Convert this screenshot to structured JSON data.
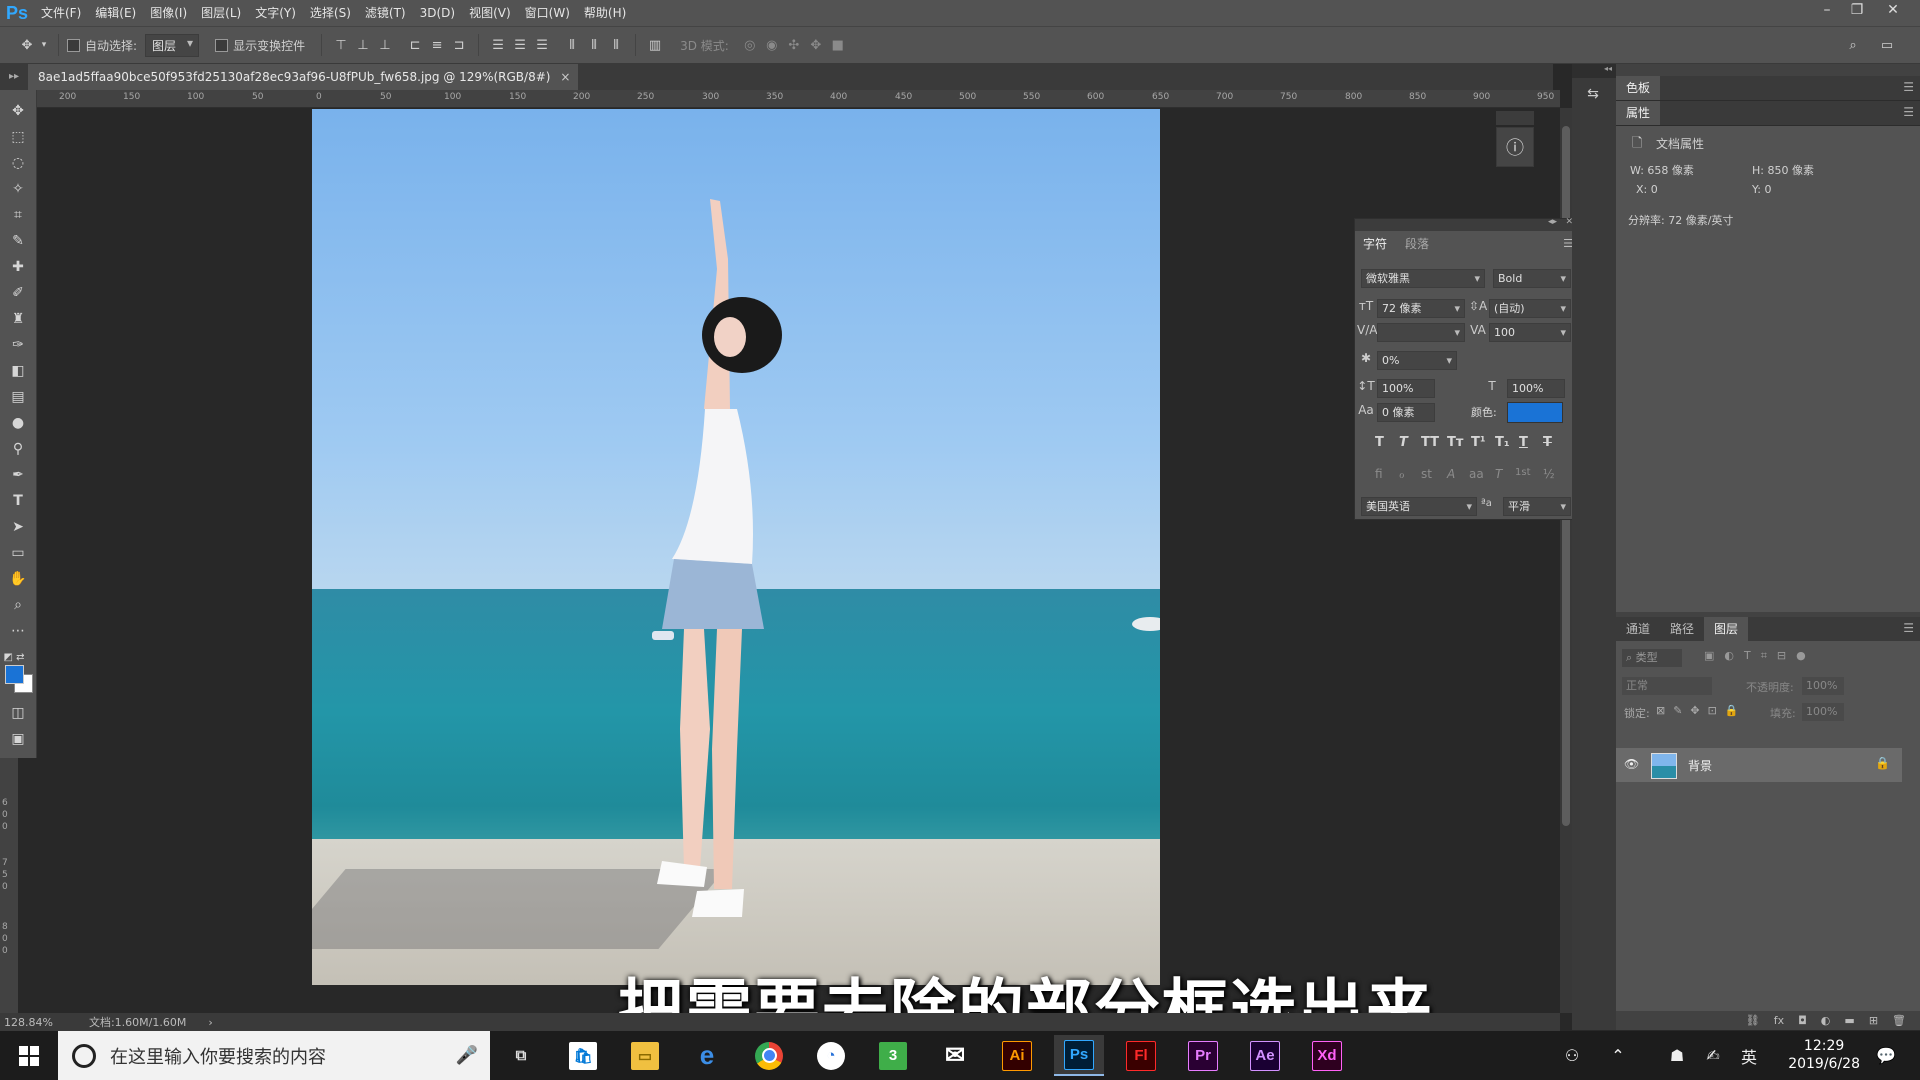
{
  "app": {
    "logo": "Ps"
  },
  "menu": [
    "文件(F)",
    "编辑(E)",
    "图像(I)",
    "图层(L)",
    "文字(Y)",
    "选择(S)",
    "滤镜(T)",
    "3D(D)",
    "视图(V)",
    "窗口(W)",
    "帮助(H)"
  ],
  "options": {
    "auto_select_label": "自动选择:",
    "auto_select_value": "图层",
    "show_transform_label": "显示变换控件",
    "mode_3d_label": "3D 模式:"
  },
  "document": {
    "tab_title": "8ae1ad5ffaa90bce50f953fd25130af28ec93af96-U8fPUb_fw658.jpg @ 129%(RGB/8#)",
    "close": "×"
  },
  "ruler_top": [
    "200",
    "150",
    "100",
    "50",
    "0",
    "50",
    "100",
    "150",
    "200",
    "250",
    "300",
    "350",
    "400",
    "450",
    "500",
    "550",
    "600",
    "650",
    "700",
    "750",
    "800",
    "850",
    "900",
    "950"
  ],
  "ruler_left": [
    "6",
    "0",
    "0",
    "7",
    "5",
    "0",
    "8",
    "0",
    "0"
  ],
  "status": {
    "zoom": "128.84%",
    "doc_size": "文档:1.60M/1.60M",
    "arrow": "›"
  },
  "subtitle": "把需要去除的部分框选出来",
  "character_panel": {
    "tabs": [
      "字符",
      "段落"
    ],
    "font_family": "微软雅黑",
    "font_style": "Bold",
    "font_size": "72 像素",
    "leading": "(自动)",
    "kerning": "",
    "tracking": "100",
    "tsume": "0%",
    "vertical_scale": "100%",
    "horizontal_scale": "100%",
    "baseline_shift": "0 像素",
    "color_label": "颜色:",
    "color": "#1a73d6",
    "type_styles": [
      "T",
      "T",
      "TT",
      "Tт",
      "T¹",
      "T₁",
      "T",
      "T"
    ],
    "opentype": [
      "fi",
      "ℴ",
      "st",
      "A",
      "aa",
      "T",
      "1st",
      "½"
    ],
    "language": "美国英语",
    "aa_label": "ªa",
    "antialias": "平滑"
  },
  "panels": {
    "swatches_tab": "色板",
    "properties_tab": "属性",
    "doc_props_label": "文档属性",
    "w": "W:  658 像素",
    "h": "H:  850 像素",
    "x": "X:  0",
    "y": "Y:  0",
    "resolution": "分辨率: 72 像素/英寸",
    "layer_tabs": [
      "通道",
      "路径",
      "图层"
    ],
    "kind_filter": "类型",
    "blend_mode": "正常",
    "opacity_label": "不透明度:",
    "opacity": "100%",
    "lock_label": "锁定:",
    "fill_label": "填充:",
    "fill": "100%",
    "layer_name": "背景"
  },
  "taskbar": {
    "search_placeholder": "在这里输入你要搜索的内容",
    "apps": [
      "Ai",
      "Ps",
      "Fl",
      "Pr",
      "Ae",
      "Xd"
    ],
    "ime": "英",
    "time": "12:29",
    "date": "2019/6/28"
  },
  "colors": {
    "foreground": "#1a73d6",
    "background": "#ffffff",
    "ps_blue": "#31a8ff"
  }
}
